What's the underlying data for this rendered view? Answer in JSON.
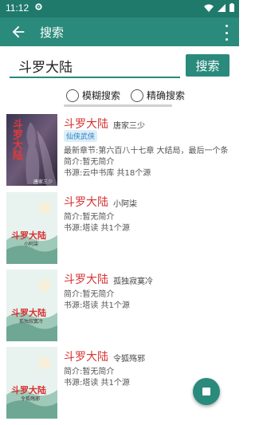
{
  "status": {
    "time": "11:12"
  },
  "app_bar": {
    "title": "搜索"
  },
  "search": {
    "query": "斗罗大陆",
    "button_label": "搜索"
  },
  "modes": [
    {
      "label": "模糊搜索"
    },
    {
      "label": "精确搜索"
    }
  ],
  "results": [
    {
      "title": "斗罗大陆",
      "author": "唐家三少",
      "tag": "仙侠武侠",
      "latest": "最新章节:第六百八十七章 大结局，最后一个条",
      "intro": "简介:暂无简介",
      "source": "书源:云中书库 共18个源",
      "cover_title": "斗罗大陆",
      "cover_author": "唐家三少"
    },
    {
      "title": "斗罗大陆",
      "author": "小阿柒",
      "intro": "简介:暂无简介",
      "source": "书源:塔读 共1个源",
      "cover_title": "斗罗大陆",
      "cover_author": "小阿柒"
    },
    {
      "title": "斗罗大陆",
      "author": "孤独寂寞冷",
      "intro": "简介:暂无简介",
      "source": "书源:塔读 共1个源",
      "cover_title": "斗罗大陆",
      "cover_author": "孤独寂寞冷"
    },
    {
      "title": "斗罗大陆",
      "author": "令狐殇邪",
      "intro": "简介:暂无简介",
      "source": "书源:塔读 共1个源",
      "cover_title": "斗罗大陆",
      "cover_author": "令狐殇邪"
    }
  ],
  "colors": {
    "primary": "#2a8a7c",
    "status_bar": "#1f7a6c",
    "title_red": "#d63333",
    "tag_blue": "#2a7fbf"
  },
  "icons": {
    "back": "arrow-left-icon",
    "more": "more-vert-icon",
    "stop": "stop-icon"
  }
}
